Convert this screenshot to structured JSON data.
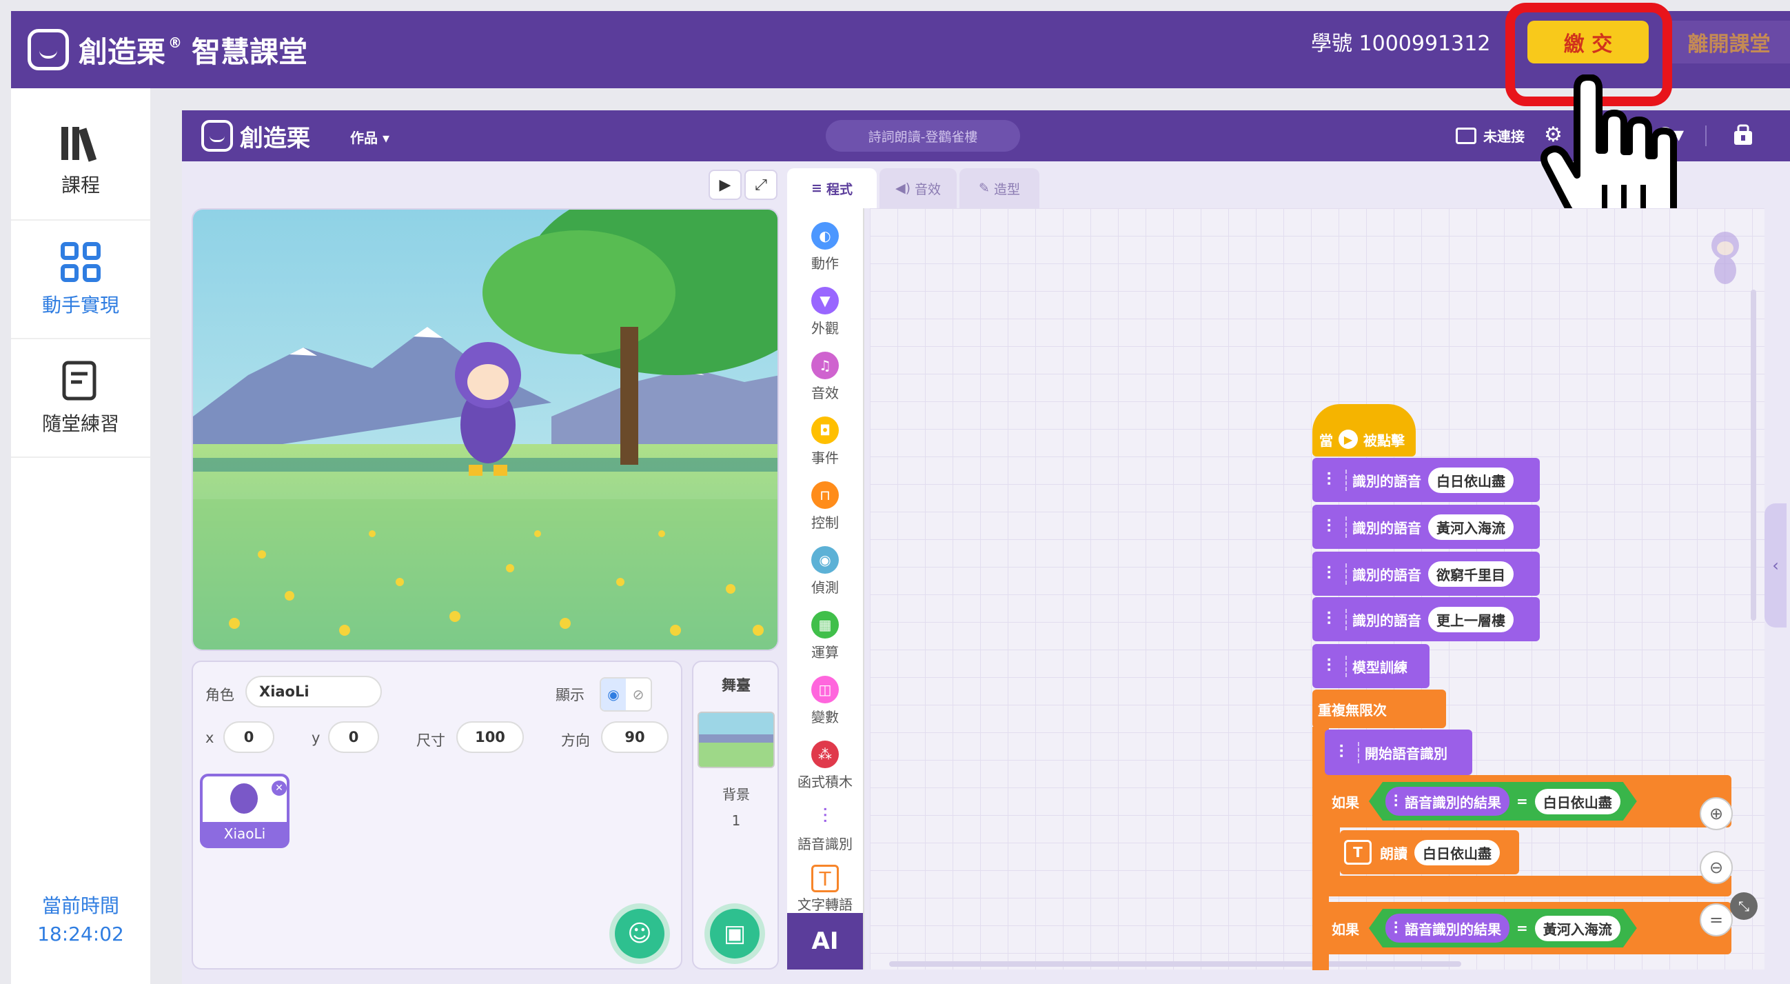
{
  "header": {
    "brand": "創造栗",
    "product": "智慧課堂",
    "student_label": "學號",
    "student_id": "1000991312",
    "submit_label": "繳 交",
    "leave_label": "離開課堂"
  },
  "sidebar": {
    "items": [
      {
        "label": "課程",
        "icon": "books-icon"
      },
      {
        "label": "動手實現",
        "icon": "grid-icon"
      },
      {
        "label": "隨堂練習",
        "icon": "exercise-icon"
      }
    ],
    "clock_label": "當前時間",
    "clock": "18:24:02"
  },
  "editor": {
    "brand": "創造栗",
    "works_menu": "作品",
    "project_title": "詩詞朗讀-登鸛雀樓",
    "connection": "未連接",
    "tabs": [
      "程式",
      "音效",
      "造型"
    ]
  },
  "sprite_panel": {
    "role_label": "角色",
    "role_value": "XiaoLi",
    "show_label": "顯示",
    "x_label": "x",
    "x_value": "0",
    "y_label": "y",
    "y_value": "0",
    "size_label": "尺寸",
    "size_value": "100",
    "dir_label": "方向",
    "dir_value": "90",
    "sprite_name": "XiaoLi"
  },
  "stage_panel": {
    "title": "舞臺",
    "backdrop_label": "背景",
    "backdrop_count": "1"
  },
  "categories": [
    {
      "label": "動作",
      "color": "#4c97ff"
    },
    {
      "label": "外觀",
      "color": "#9966ff"
    },
    {
      "label": "音效",
      "color": "#cf63cf"
    },
    {
      "label": "事件",
      "color": "#ffbf00"
    },
    {
      "label": "控制",
      "color": "#ff8c1a"
    },
    {
      "label": "偵測",
      "color": "#5cb1d6"
    },
    {
      "label": "運算",
      "color": "#40bf4a"
    },
    {
      "label": "變數",
      "color": "#ff66dd"
    },
    {
      "label": "函式積木",
      "color": "#e0394b"
    },
    {
      "label": "語音識別",
      "color": "#9b5fe8"
    },
    {
      "label": "文字轉語",
      "color": "#f7852a"
    }
  ],
  "ai_label": "AI",
  "blocks": {
    "hat_when": "當",
    "hat_clicked": "被點擊",
    "recognize_label": "識別的語音",
    "phrases": [
      "白日依山盡",
      "黃河入海流",
      "欲窮千里目",
      "更上一層樓"
    ],
    "train": "模型訓練",
    "forever": "重複無限次",
    "start_recognition": "開始語音識別",
    "if_label": "如果",
    "result_label": "語音識別的結果",
    "equals": "=",
    "read_label": "朗讀",
    "if1_value": "白日依山盡",
    "read1_value": "白日依山盡",
    "if2_value": "黃河入海流"
  }
}
